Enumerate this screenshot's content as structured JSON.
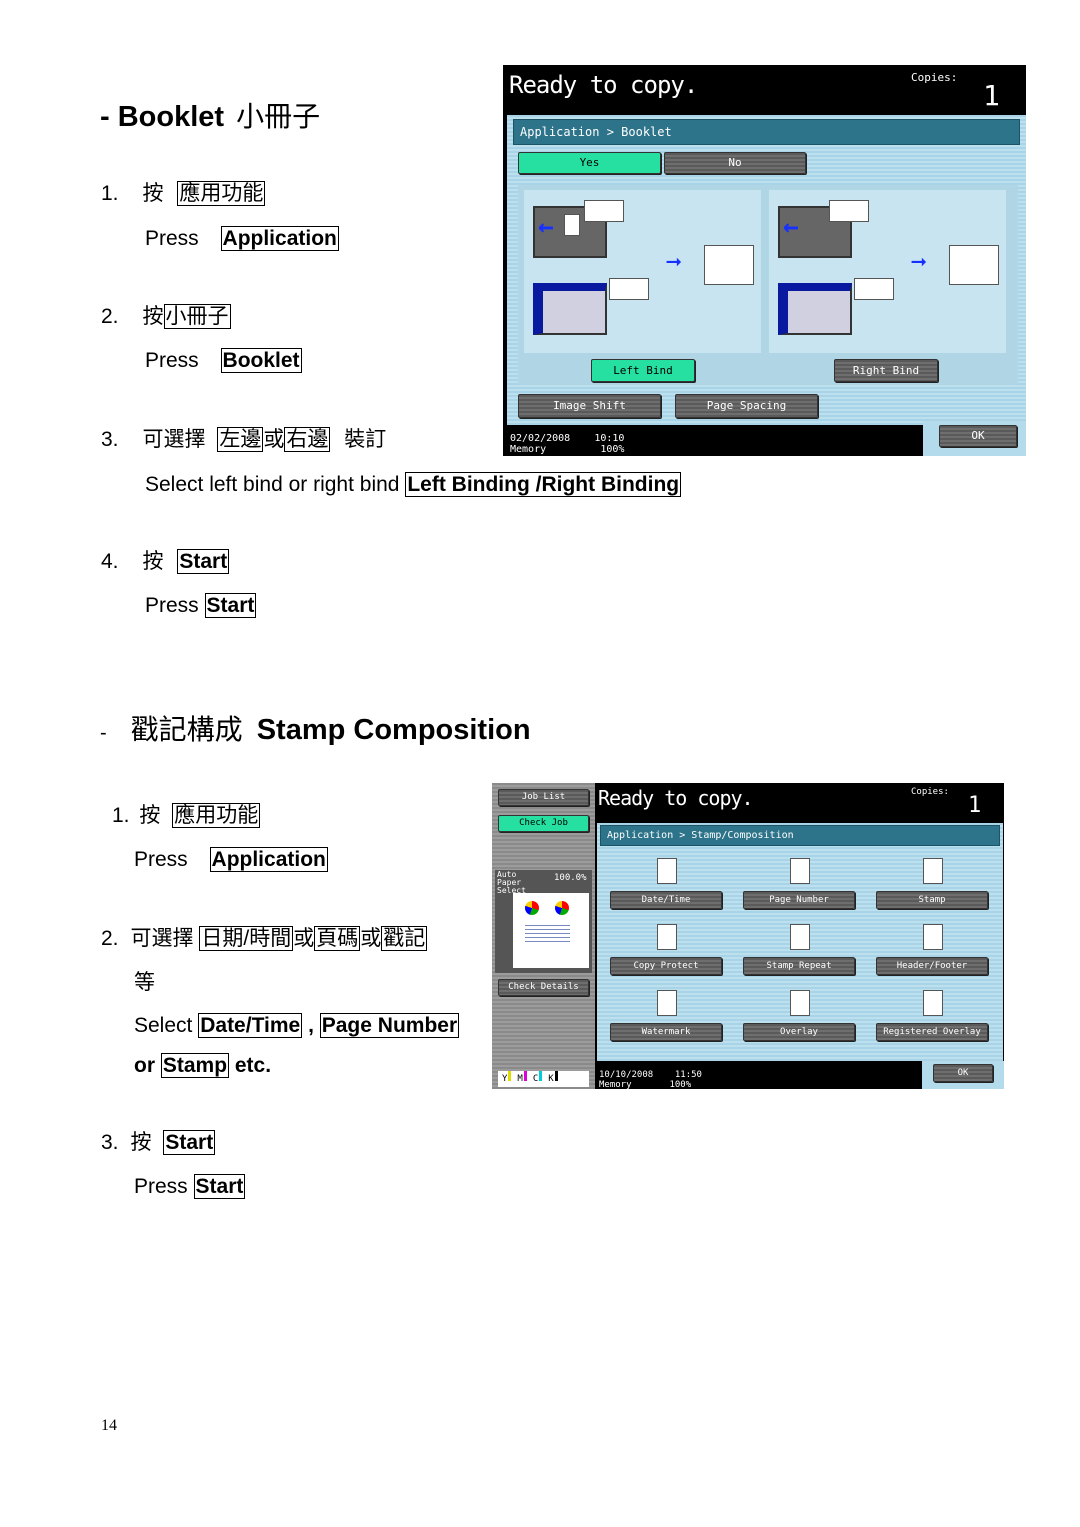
{
  "booklet": {
    "title_dash": "- Booklet",
    "title_cjk": "小冊子",
    "steps": [
      {
        "num": "1.",
        "cn_prefix": "按",
        "cn_box": "應用功能",
        "en_prefix": "Press",
        "en_box": "Application"
      },
      {
        "num": "2.",
        "cn_prefix": "按",
        "cn_box": "小冊子",
        "en_prefix": "Press",
        "en_box": "Booklet"
      },
      {
        "num": "3.",
        "cn_prefix": "可選擇",
        "cn_box1": "左邊",
        "cn_mid": "或",
        "cn_box2": "右邊",
        "cn_suffix": "裝訂",
        "en_prefix": "Select left bind or right bind",
        "en_box": "Left Binding /Right Binding"
      },
      {
        "num": "4.",
        "cn_prefix": "按",
        "cn_box": "Start",
        "en_prefix": "Press",
        "en_box": "Start"
      }
    ],
    "screen": {
      "status": "Ready to copy.",
      "copies_label": "Copies:",
      "copies": "1",
      "breadcrumb": "Application > Booklet",
      "yes": "Yes",
      "no": "No",
      "left_bind": "Left Bind",
      "right_bind": "Right Bind",
      "image_shift": "Image Shift",
      "page_spacing": "Page Spacing",
      "date": "02/02/2008",
      "time": "10:10",
      "memory_label": "Memory",
      "memory": "100%",
      "ok": "OK"
    }
  },
  "stamp": {
    "title_dash": "-",
    "title_cjk": "戳記構成",
    "title_en": "Stamp Composition",
    "steps": [
      {
        "num": "1.",
        "cn_prefix": "按",
        "cn_box": "應用功能",
        "en_prefix": "Press",
        "en_box": "Application"
      },
      {
        "num": "2.",
        "cn_prefix": "可選擇",
        "cn_box1": "日期/時間",
        "cn_or1": "或",
        "cn_box2": "頁碼",
        "cn_or2": "或",
        "cn_box3": "戳記",
        "cn_line2": "等",
        "en_prefix": "Select",
        "en_box1": "Date/Time",
        "en_comma": ",",
        "en_box2": "Page Number",
        "en_or": "or",
        "en_box3": "Stamp",
        "en_etc": "etc."
      },
      {
        "num": "3.",
        "cn_prefix": "按",
        "cn_box": "Start",
        "en_prefix": "Press",
        "en_box": "Start"
      }
    ],
    "screen": {
      "job_list": "Job List",
      "check_job": "Check Job",
      "paper": "Auto Paper Select",
      "zoom": "100.0%",
      "check_details": "Check Details",
      "toner": [
        "Y",
        "M",
        "C",
        "K"
      ],
      "status": "Ready to copy.",
      "copies_label": "Copies:",
      "copies": "1",
      "breadcrumb": "Application > Stamp/Composition",
      "buttons": [
        "Date/Time",
        "Page Number",
        "Stamp",
        "Copy Protect",
        "Stamp Repeat",
        "Header/Footer",
        "Watermark",
        "Overlay",
        "Registered Overlay"
      ],
      "date": "10/10/2008",
      "time": "11:50",
      "memory_label": "Memory",
      "memory": "100%",
      "ok": "OK"
    }
  },
  "page_number": "14",
  "colors": {
    "accent_green": "#25e0a0",
    "breadcrumb_teal": "#2d7389",
    "panel_blue": "#b3dbeb"
  }
}
